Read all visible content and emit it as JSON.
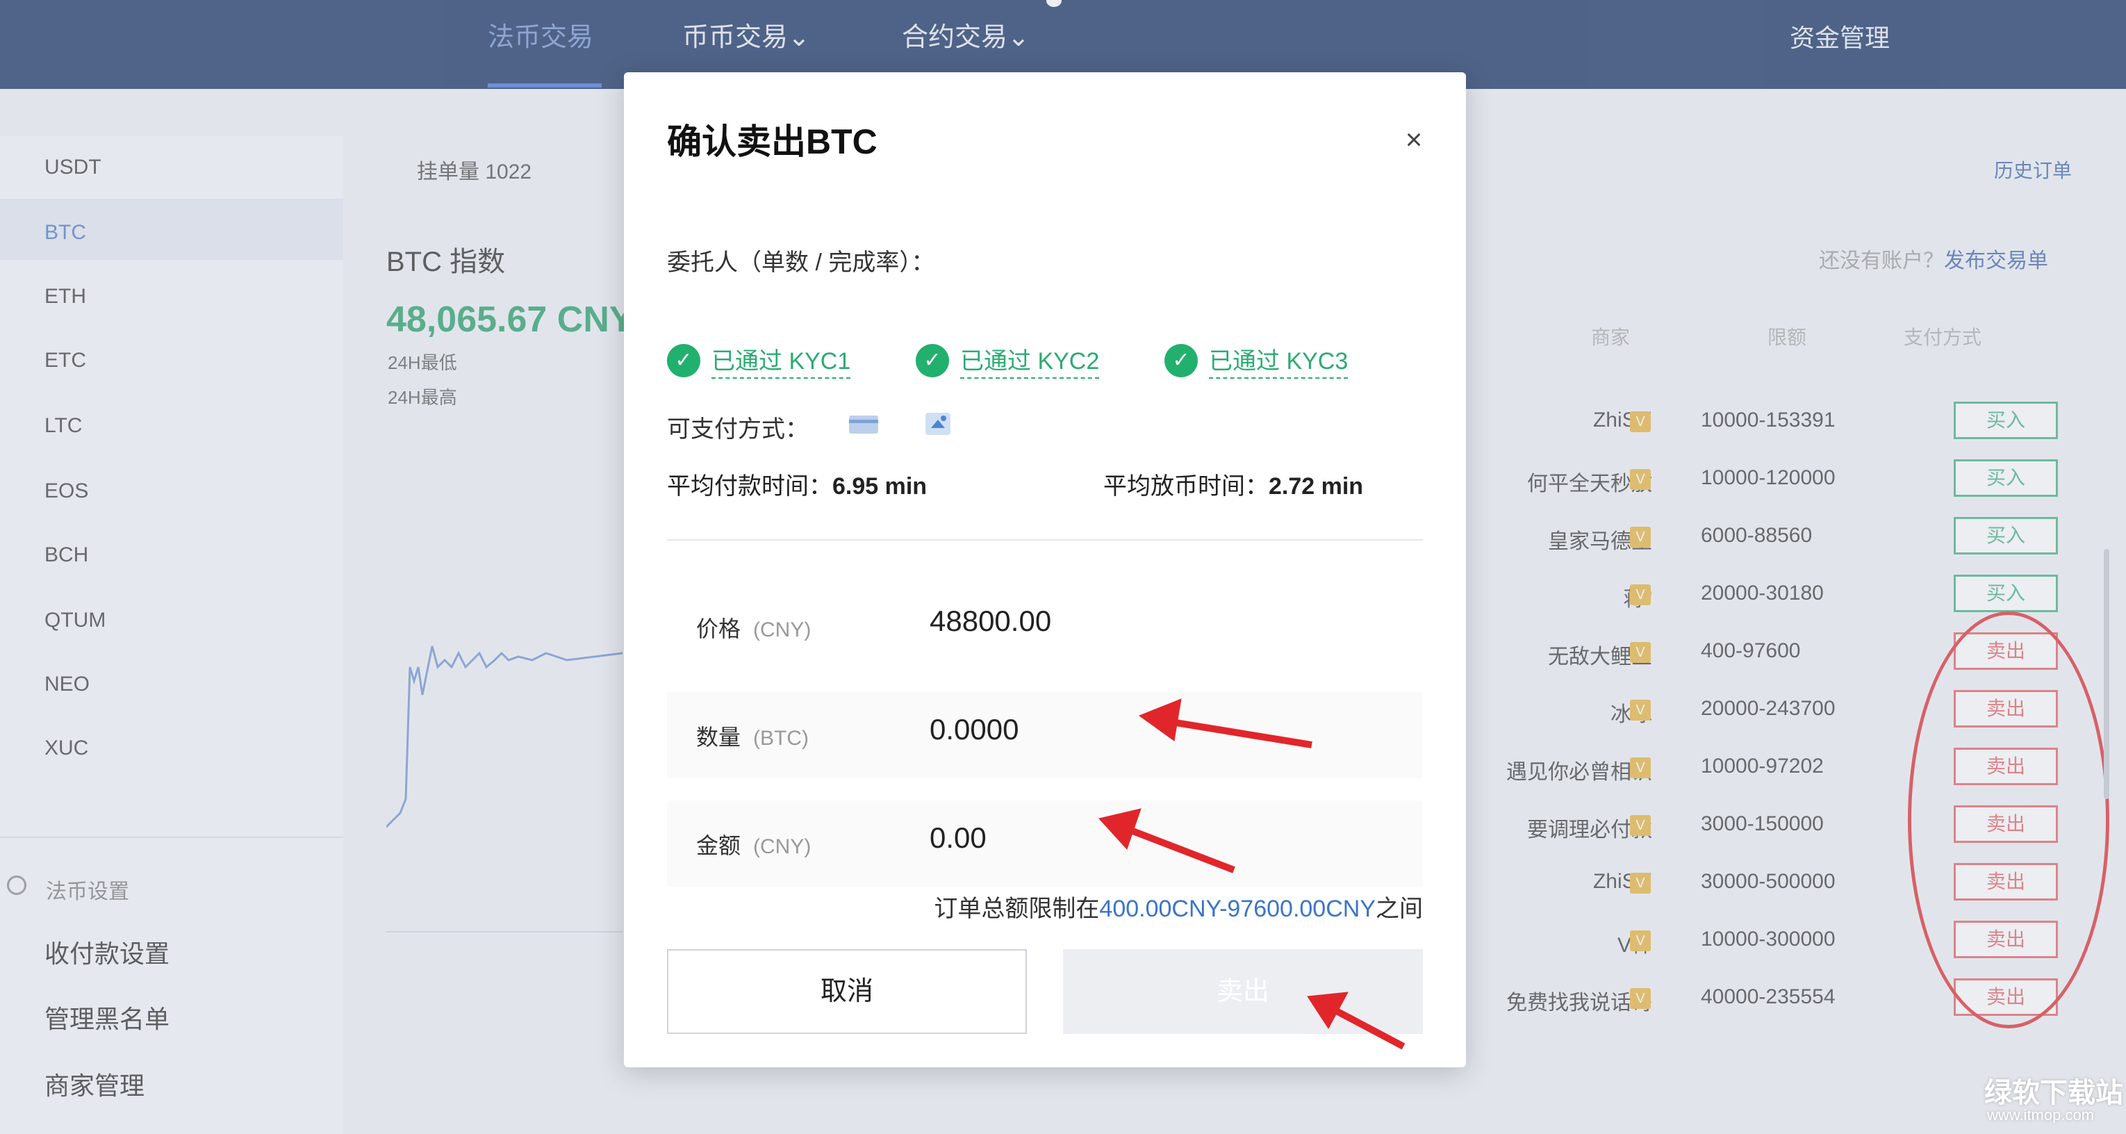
{
  "nav": {
    "items": [
      "法币交易",
      "币币交易",
      "合约交易"
    ],
    "right": [
      "资金管理",
      "",
      ""
    ]
  },
  "sidebar": {
    "coins": [
      "USDT",
      "BTC",
      "ETH",
      "ETC",
      "LTC",
      "EOS",
      "BCH",
      "QTUM",
      "NEO",
      "XUC"
    ],
    "settings_title": "法币设置",
    "links": [
      "收付款设置",
      "管理黑名单",
      "商家管理"
    ]
  },
  "middle": {
    "tab_text": "挂单量 1022",
    "index_title": "BTC 指数",
    "index_value": "48,065.67 CNY",
    "stat1": "24H最低",
    "stat2": "24H最高"
  },
  "right": {
    "top_link": "历史订单",
    "hint": "还没有账户？",
    "hint_link": "发布交易单",
    "columns": [
      "商家",
      "限额",
      "支付方式"
    ],
    "rows": [
      {
        "name": "ZhiSui",
        "limit": "10000-153391",
        "action": "买入",
        "type": "buy"
      },
      {
        "name": "何平全天秒放",
        "limit": "10000-120000",
        "action": "买入",
        "type": "buy"
      },
      {
        "name": "皇家马德里",
        "limit": "6000-88560",
        "action": "买入",
        "type": "buy"
      },
      {
        "name": "蒋''",
        "limit": "20000-30180",
        "action": "买入",
        "type": "buy"
      },
      {
        "name": "无敌大鲤鱼",
        "limit": "400-97600",
        "action": "卖出",
        "type": "sell"
      },
      {
        "name": "冰冰",
        "limit": "20000-243700",
        "action": "卖出",
        "type": "sell"
      },
      {
        "name": "遇见你必曾相识",
        "limit": "10000-97202",
        "action": "卖出",
        "type": "sell"
      },
      {
        "name": "要调理必付款",
        "limit": "3000-150000",
        "action": "卖出",
        "type": "sell"
      },
      {
        "name": "ZhiSui",
        "limit": "30000-500000",
        "action": "卖出",
        "type": "sell"
      },
      {
        "name": "V神",
        "limit": "10000-300000",
        "action": "卖出",
        "type": "sell"
      },
      {
        "name": "免费找我说话哥",
        "limit": "40000-235554",
        "action": "卖出",
        "type": "sell"
      }
    ]
  },
  "modal": {
    "title": "确认卖出BTC",
    "close_glyph": "×",
    "entrustor_label": "委托人（单数 / 完成率）：",
    "kyc": [
      "已通过 KYC1",
      "已通过 KYC2",
      "已通过 KYC3"
    ],
    "check_glyph": "✓",
    "payment_label": "可支付方式：",
    "avg_pay_label": "平均付款时间：",
    "avg_pay_value": "6.95 min",
    "avg_release_label": "平均放币时间：",
    "avg_release_value": "2.72 min",
    "price_label": "价格",
    "price_unit": "(CNY)",
    "price_value": "48800.00",
    "qty_label": "数量",
    "qty_unit": "(BTC)",
    "qty_value": "0.0000",
    "amount_label": "金额",
    "amount_unit": "(CNY)",
    "amount_value": "0.00",
    "note_prefix": "订单总额限制在",
    "note_range": "400.00CNY-97600.00CNY",
    "note_suffix": "之间",
    "cancel_label": "取消",
    "confirm_label": "卖出"
  },
  "watermark": {
    "brand": "绿软下载站",
    "url": "www.itmop.com"
  },
  "colors": {
    "nav_bg": "#0f2a5e",
    "buy": "#3fae7f",
    "sell": "#e65b62",
    "kyc": "#22b06e",
    "annotation": "#e1262b"
  }
}
